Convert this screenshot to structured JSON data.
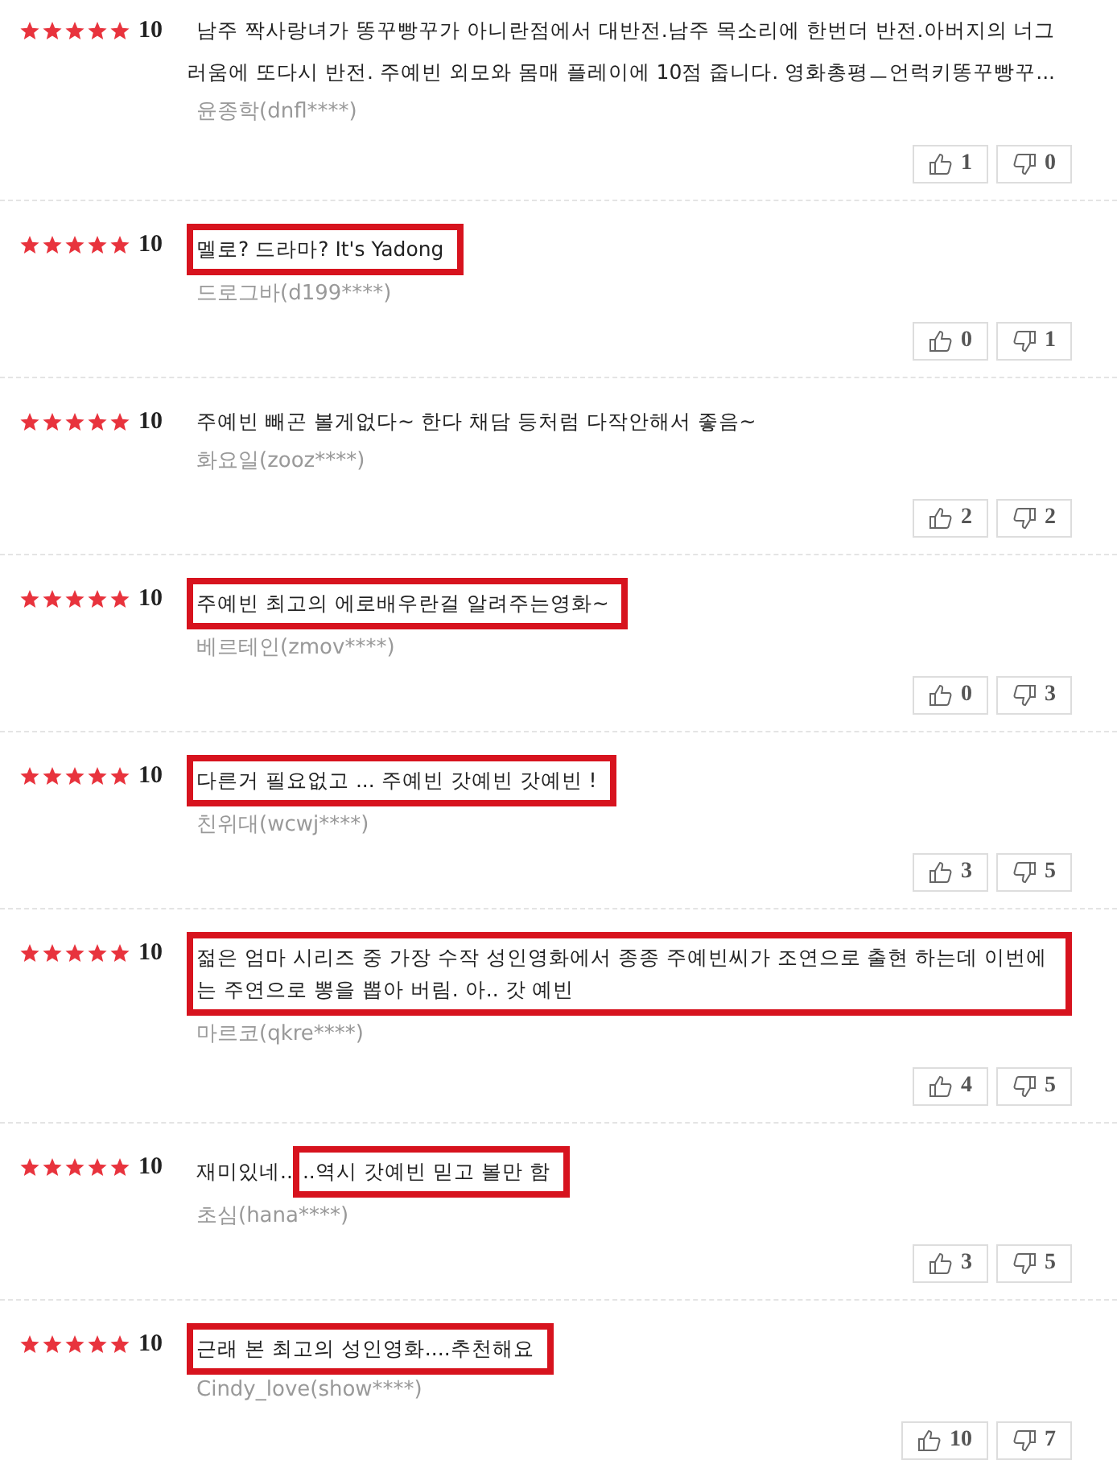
{
  "reviews": [
    {
      "stars": 5,
      "score": "10",
      "segments": [
        {
          "text": "남주 짝사랑녀가 똥꾸빵꾸가 아니란점에서 대반전.남주 목소리에 한번더 반전.아버지의 너그러움에 또다시 반전. 주예빈 외모와 몸매 플레이에 10점 줍니다. 영화총평ㅡ언럭키똥꾸빵꾸...",
          "highlighted": false
        }
      ],
      "author": "윤종학(dnfl****)",
      "likes": "1",
      "dislikes": "0"
    },
    {
      "stars": 5,
      "score": "10",
      "segments": [
        {
          "text": "멜로? 드라마? It's Yadong",
          "highlighted": true
        }
      ],
      "author": "드로그바(d199****)",
      "likes": "0",
      "dislikes": "1"
    },
    {
      "stars": 5,
      "score": "10",
      "segments": [
        {
          "text": "주예빈 빼곤 볼게없다~ 한다 채담 등처럼 다작안해서 좋음~",
          "highlighted": false
        }
      ],
      "author": "화요일(zooz****)",
      "likes": "2",
      "dislikes": "2"
    },
    {
      "stars": 5,
      "score": "10",
      "segments": [
        {
          "text": "주예빈 최고의 에로배우란걸 알려주는영화~",
          "highlighted": true
        }
      ],
      "author": "베르테인(zmov****)",
      "likes": "0",
      "dislikes": "3"
    },
    {
      "stars": 5,
      "score": "10",
      "segments": [
        {
          "text": "다른거 필요없고 ... 주예빈 갓예빈 갓예빈 !",
          "highlighted": true
        }
      ],
      "author": "친위대(wcwj****)",
      "likes": "3",
      "dislikes": "5"
    },
    {
      "stars": 5,
      "score": "10",
      "segments": [
        {
          "text": "젊은 엄마 시리즈 중 가장 수작 성인영화에서 종종 주예빈씨가 조연으로 출현 하는데 이번에는 주연으로 뽕을 뽑아 버림. 아.. 갓 예빈",
          "highlighted": true
        }
      ],
      "author": "마르코(qkre****)",
      "likes": "4",
      "dislikes": "5"
    },
    {
      "stars": 5,
      "score": "10",
      "segments": [
        {
          "text": "재미있네..",
          "highlighted": false
        },
        {
          "text": "..역시 갓예빈 믿고 볼만 함",
          "highlighted": true
        }
      ],
      "author": "초심(hana****)",
      "likes": "3",
      "dislikes": "5"
    },
    {
      "stars": 5,
      "score": "10",
      "segments": [
        {
          "text": "근래 본 최고의 성인영화....추천해요",
          "highlighted": true
        }
      ],
      "author": "Cindy_love(show****)",
      "likes": "10",
      "dislikes": "7"
    }
  ]
}
